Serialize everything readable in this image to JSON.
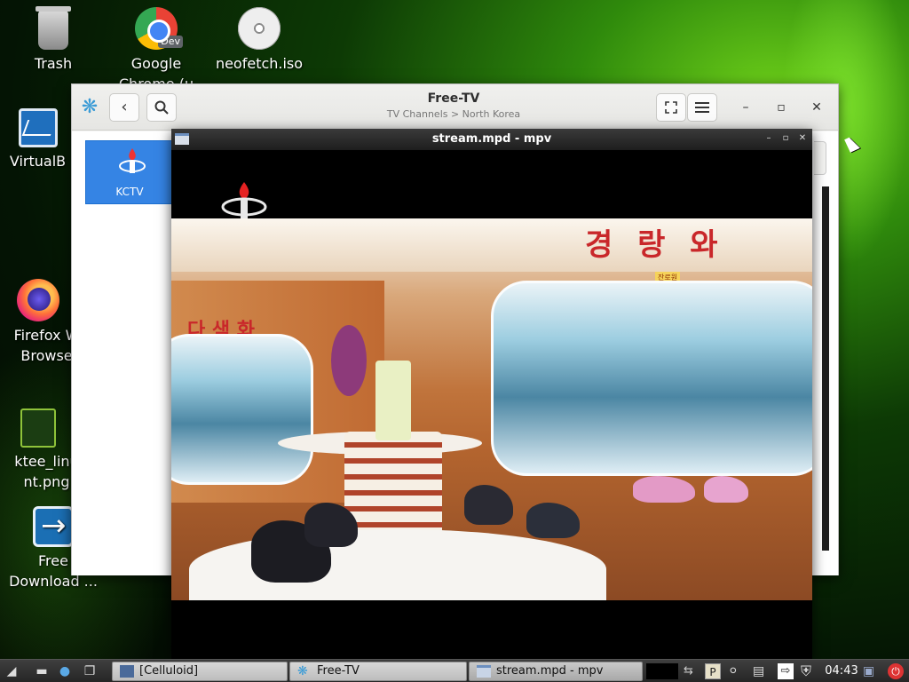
{
  "desktop": {
    "icons": [
      {
        "label": "Trash"
      },
      {
        "label": "Google Chrome (u"
      },
      {
        "label": "neofetch.iso"
      },
      {
        "label": "VirtualB"
      },
      {
        "label": "Firefox W Browse"
      },
      {
        "label": "ktee_linu nt.png"
      },
      {
        "label": "Free Download ..."
      }
    ],
    "chrome_badge": "Dev"
  },
  "freetv": {
    "title": "Free-TV",
    "subtitle": "TV Channels > North Korea",
    "channels": [
      {
        "label": "KCTV"
      }
    ]
  },
  "mpv": {
    "title": "stream.mpd - mpv",
    "video": {
      "sign_main": "경 랑 와",
      "sign_left": "다 색 화",
      "tag": "잔로원"
    }
  },
  "taskbar": {
    "tasks": [
      {
        "label": "[Celluloid]"
      },
      {
        "label": "Free-TV"
      },
      {
        "label": "stream.mpd - mpv"
      }
    ],
    "clock": "04:43",
    "tray_p_label": "P"
  },
  "colors": {
    "accent": "#3584e4",
    "desktop_green": "#2f8a0c",
    "sign_red": "#c9272a"
  }
}
